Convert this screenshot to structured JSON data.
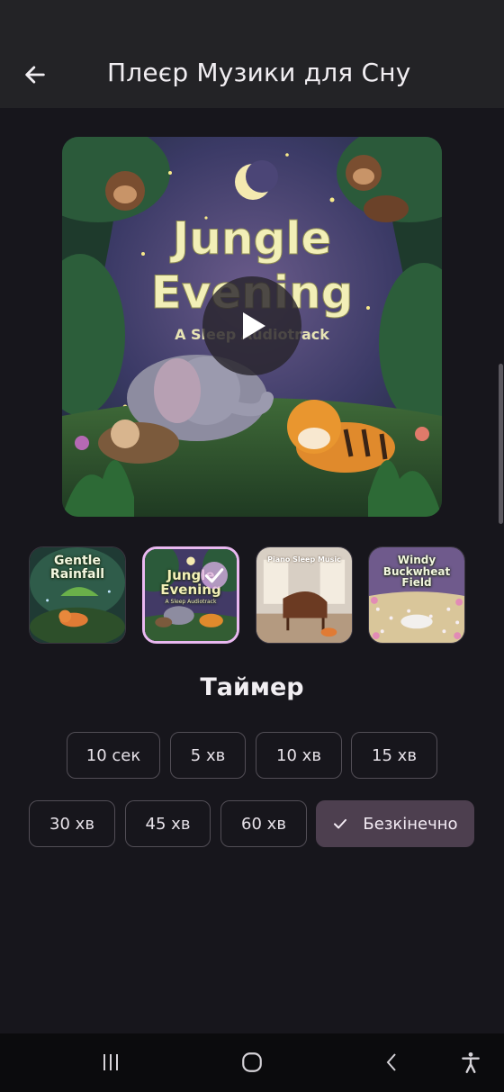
{
  "header": {
    "title": "Плеєр Музики для Сну",
    "back_icon": "arrow-left-icon"
  },
  "now_playing": {
    "cover_title_line1": "Jungle",
    "cover_title_line2": "Evening",
    "cover_subtitle": "A Sleep Audiotrack",
    "play_icon": "play-icon"
  },
  "tracks": [
    {
      "title_line1": "Gentle",
      "title_line2": "Rainfall",
      "selected": false
    },
    {
      "title_line1": "Jungle",
      "title_line2": "Evening",
      "subtitle": "A Sleep Audiotrack",
      "selected": true
    },
    {
      "title_line1": "Piano Sleep Music",
      "selected": false
    },
    {
      "title_line1": "Windy",
      "title_line2": "Buckwheat",
      "title_line3": "Field",
      "selected": false
    }
  ],
  "timer": {
    "title": "Таймер",
    "options": [
      "10 сек",
      "5 хв",
      "10 хв",
      "15 хв",
      "30 хв",
      "45 хв",
      "60 хв",
      "Безкінечно"
    ],
    "selected": "Безкінечно"
  },
  "colors": {
    "accent": "#e9b8f0",
    "selected_chip": "#4d3f4f",
    "background": "#17161c"
  },
  "nav": {
    "icons": [
      "recent-apps-icon",
      "home-icon",
      "back-icon",
      "accessibility-icon"
    ]
  }
}
